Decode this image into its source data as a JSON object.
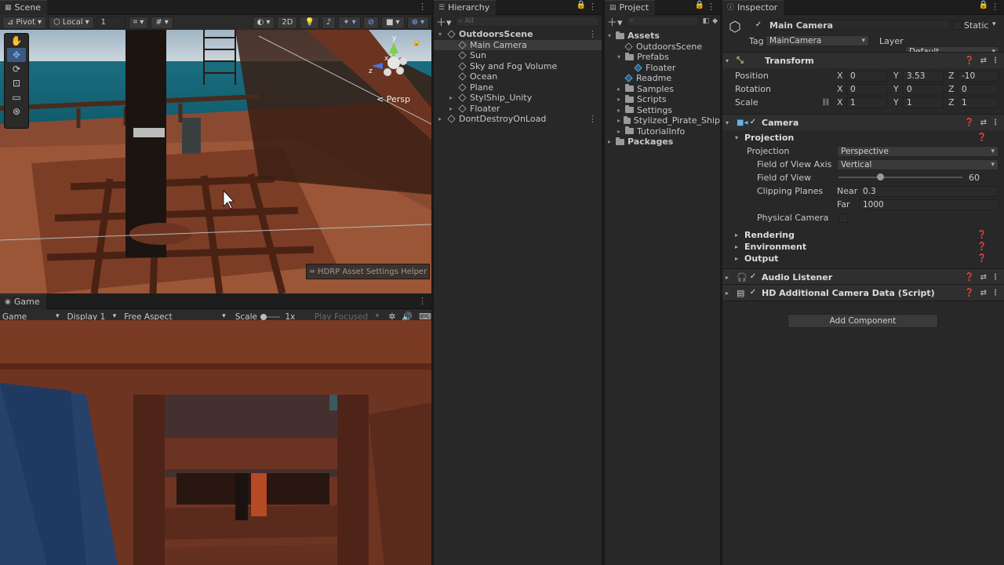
{
  "scene": {
    "tab": "Scene",
    "toolbar": {
      "pivot": "Pivot",
      "local": "Local",
      "grid": "1",
      "mode2d": "2D"
    },
    "persp": "Persp",
    "gizmo": {
      "y": "y",
      "x": "x",
      "z": "z"
    },
    "overlay": "HDRP Asset Settings Helper"
  },
  "game": {
    "tab": "Game",
    "toolbar": {
      "mode": "Game",
      "display": "Display 1",
      "aspect": "Free Aspect",
      "scale_label": "Scale",
      "scale_value": "1x",
      "play_focused": "Play Focused"
    }
  },
  "hierarchy": {
    "tab": "Hierarchy",
    "search_placeholder": "All",
    "items": [
      {
        "label": "OutdoorsScene",
        "depth": 0,
        "expanded": true,
        "bold": true,
        "selected": false,
        "kebab": true
      },
      {
        "label": "Main Camera",
        "depth": 1,
        "selected": true
      },
      {
        "label": "Sun",
        "depth": 1
      },
      {
        "label": "Sky and Fog Volume",
        "depth": 1
      },
      {
        "label": "Ocean",
        "depth": 1
      },
      {
        "label": "Plane",
        "depth": 1
      },
      {
        "label": "StylShip_Unity",
        "depth": 1,
        "has_children": true
      },
      {
        "label": "Floater",
        "depth": 1,
        "has_children": true
      },
      {
        "label": "DontDestroyOnLoad",
        "depth": 0,
        "has_children": true,
        "kebab": true
      }
    ]
  },
  "project": {
    "tab": "Project",
    "items": [
      {
        "label": "Assets",
        "depth": 0,
        "type": "folder",
        "expanded": true,
        "bold": true
      },
      {
        "label": "OutdoorsScene",
        "depth": 1,
        "type": "scene"
      },
      {
        "label": "Prefabs",
        "depth": 1,
        "type": "folder",
        "expanded": true
      },
      {
        "label": "Floater",
        "depth": 2,
        "type": "prefab"
      },
      {
        "label": "Readme",
        "depth": 1,
        "type": "prefab"
      },
      {
        "label": "Samples",
        "depth": 1,
        "type": "folder",
        "has_children": true
      },
      {
        "label": "Scripts",
        "depth": 1,
        "type": "folder",
        "has_children": true
      },
      {
        "label": "Settings",
        "depth": 1,
        "type": "folder",
        "has_children": true
      },
      {
        "label": "Stylized_Pirate_Ship",
        "depth": 1,
        "type": "folder",
        "has_children": true
      },
      {
        "label": "TutorialInfo",
        "depth": 1,
        "type": "folder",
        "has_children": true
      },
      {
        "label": "Packages",
        "depth": 0,
        "type": "folder",
        "has_children": true,
        "bold": true
      }
    ]
  },
  "inspector": {
    "tab": "Inspector",
    "object_name": "Main Camera",
    "static_label": "Static",
    "tag_label": "Tag",
    "tag_value": "MainCamera",
    "layer_label": "Layer",
    "layer_value": "Default",
    "transform": {
      "title": "Transform",
      "position_label": "Position",
      "rotation_label": "Rotation",
      "scale_label": "Scale",
      "axis_x": "X",
      "axis_y": "Y",
      "axis_z": "Z",
      "position": {
        "x": "0",
        "y": "3.53",
        "z": "-10"
      },
      "rotation": {
        "x": "0",
        "y": "0",
        "z": "0"
      },
      "scale": {
        "x": "1",
        "y": "1",
        "z": "1"
      }
    },
    "camera": {
      "title": "Camera",
      "projection_section": "Projection",
      "projection_label": "Projection",
      "projection_value": "Perspective",
      "fov_axis_label": "Field of View Axis",
      "fov_axis_value": "Vertical",
      "fov_label": "Field of View",
      "fov_value": "60",
      "fov_fraction": 0.333,
      "clipping_label": "Clipping Planes",
      "near_label": "Near",
      "near_value": "0.3",
      "far_label": "Far",
      "far_value": "1000",
      "physical_label": "Physical Camera",
      "rendering": "Rendering",
      "environment": "Environment",
      "output": "Output"
    },
    "audio_listener": "Audio Listener",
    "hd_camera_data": "HD Additional Camera Data (Script)",
    "add_component": "Add Component"
  }
}
